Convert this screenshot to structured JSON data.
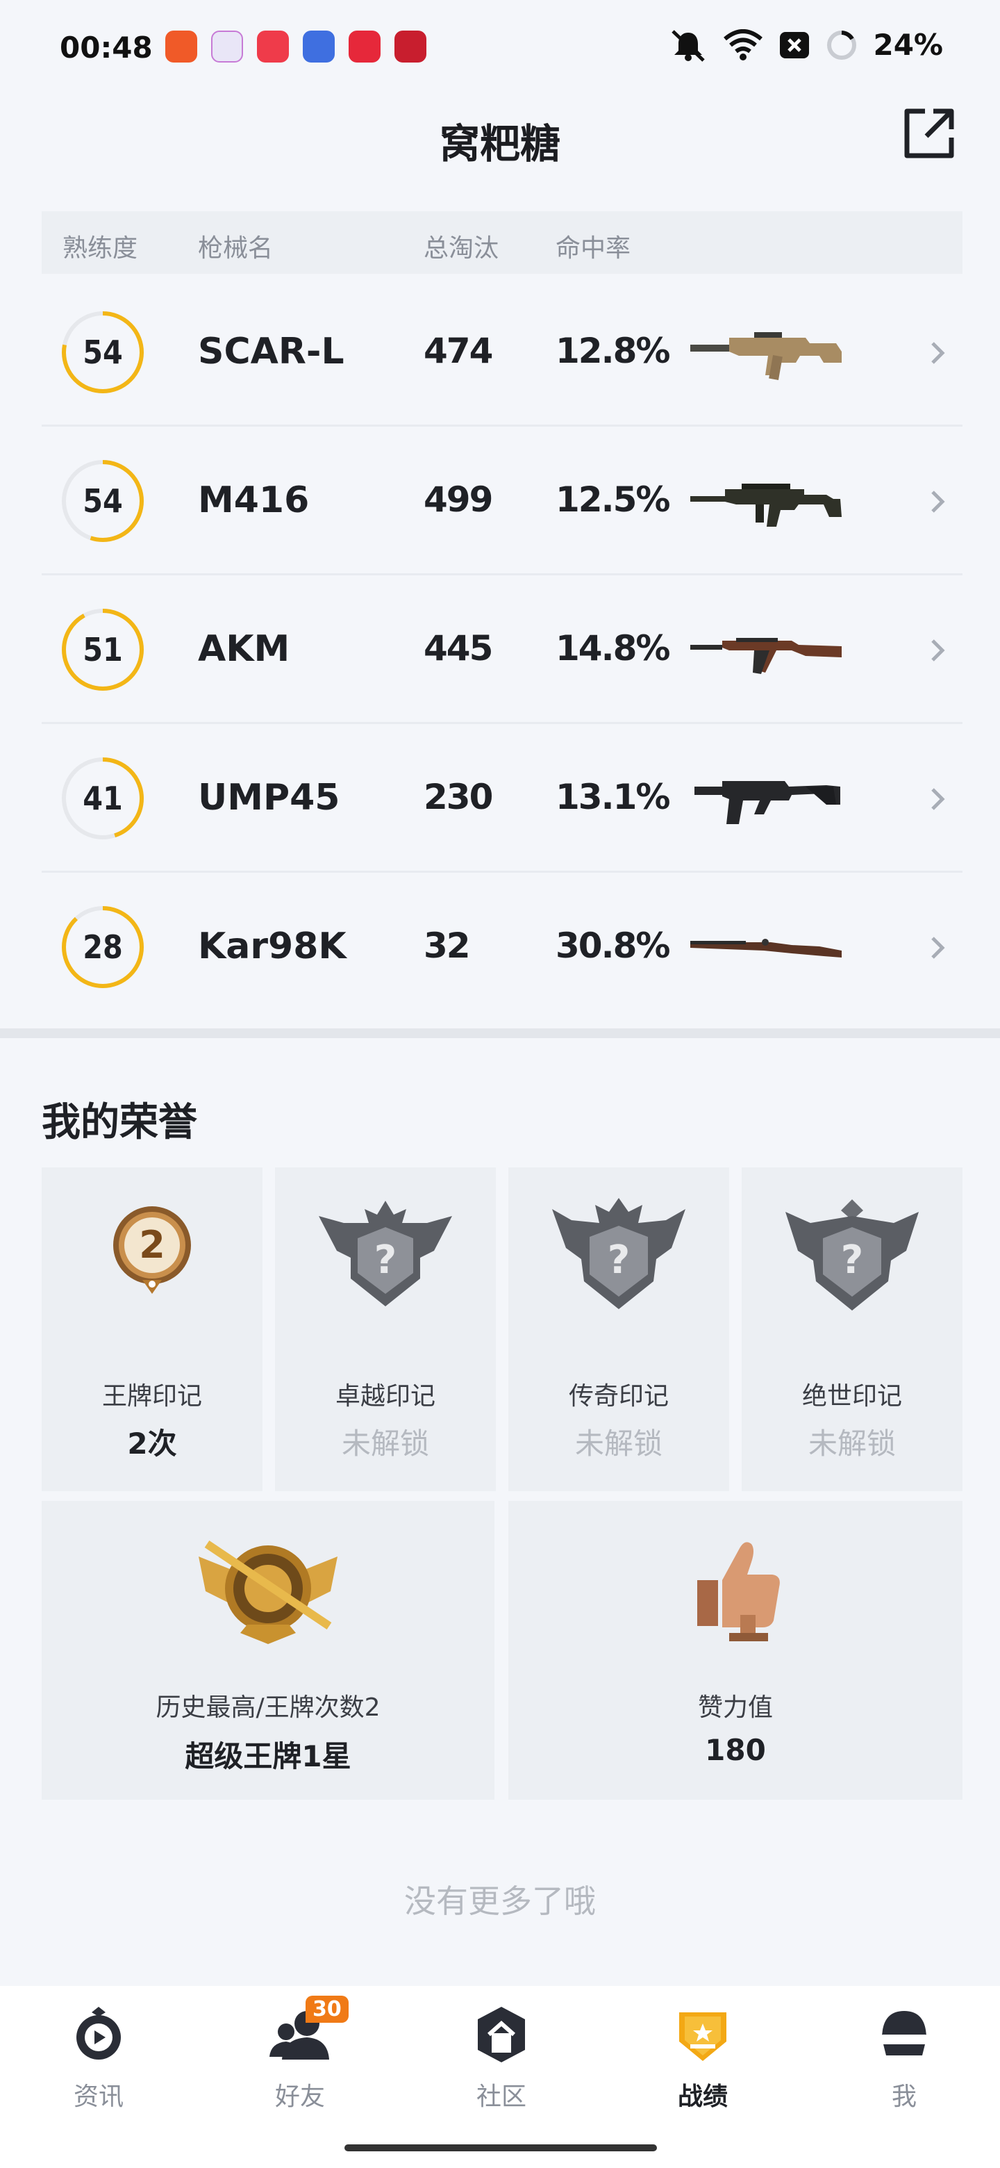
{
  "status_bar": {
    "time": "00:48",
    "battery": "24%",
    "icons": [
      "mute-icon",
      "wifi-icon",
      "x-box-icon",
      "battery-ring-icon"
    ],
    "app_icon_colors": [
      "#f05a28",
      "#e9e6f7",
      "#ef3b4a",
      "#3f6fe0",
      "#e6283a",
      "#c81e2e"
    ]
  },
  "header": {
    "title": "窝粑糖",
    "share_icon": "share-external-icon"
  },
  "table": {
    "columns": [
      "熟练度",
      "枪械名",
      "总淘汰",
      "命中率"
    ],
    "rows": [
      {
        "proficiency": "54",
        "proficiency_fraction": 0.78,
        "name": "SCAR-L",
        "kills": "474",
        "hit_rate": "12.8%",
        "gun_icon": "scar-l-rifle-icon",
        "gun_color": "#a88c63"
      },
      {
        "proficiency": "54",
        "proficiency_fraction": 0.55,
        "name": "M416",
        "kills": "499",
        "hit_rate": "12.5%",
        "gun_icon": "m416-rifle-icon",
        "gun_color": "#2f3128"
      },
      {
        "proficiency": "51",
        "proficiency_fraction": 0.92,
        "name": "AKM",
        "kills": "445",
        "hit_rate": "14.8%",
        "gun_icon": "akm-rifle-icon",
        "gun_color": "#6b3a26"
      },
      {
        "proficiency": "41",
        "proficiency_fraction": 0.45,
        "name": "UMP45",
        "kills": "230",
        "hit_rate": "13.1%",
        "gun_icon": "ump45-smg-icon",
        "gun_color": "#26272a"
      },
      {
        "proficiency": "28",
        "proficiency_fraction": 0.88,
        "name": "Kar98K",
        "kills": "32",
        "hit_rate": "30.8%",
        "gun_icon": "kar98k-rifle-icon",
        "gun_color": "#5a3424"
      }
    ]
  },
  "honors": {
    "title": "我的荣誉",
    "marks": [
      {
        "label": "王牌印记",
        "value": "2次",
        "locked": false,
        "badge_number": "2"
      },
      {
        "label": "卓越印记",
        "value": "未解锁",
        "locked": true
      },
      {
        "label": "传奇印记",
        "value": "未解锁",
        "locked": true
      },
      {
        "label": "绝世印记",
        "value": "未解锁",
        "locked": true
      }
    ],
    "wide": [
      {
        "label": "历史最高/王牌次数2",
        "value": "超级王牌1星",
        "icon": "ace-rank-emblem-icon"
      },
      {
        "label": "赞力值",
        "value": "180",
        "icon": "thumbs-up-trophy-icon"
      }
    ]
  },
  "footer_note": "没有更多了哦",
  "bottom_nav": {
    "items": [
      {
        "label": "资讯",
        "icon": "news-play-icon",
        "active": false
      },
      {
        "label": "好友",
        "icon": "friends-icon",
        "active": false,
        "badge": "30"
      },
      {
        "label": "社区",
        "icon": "community-hex-icon",
        "active": false
      },
      {
        "label": "战绩",
        "icon": "record-shield-icon",
        "active": true
      },
      {
        "label": "我",
        "icon": "helmet-profile-icon",
        "active": false
      }
    ],
    "accent": "#f3a814"
  },
  "colors": {
    "ring_accent": "#f3b616",
    "ring_track": "#e6e8ec"
  }
}
